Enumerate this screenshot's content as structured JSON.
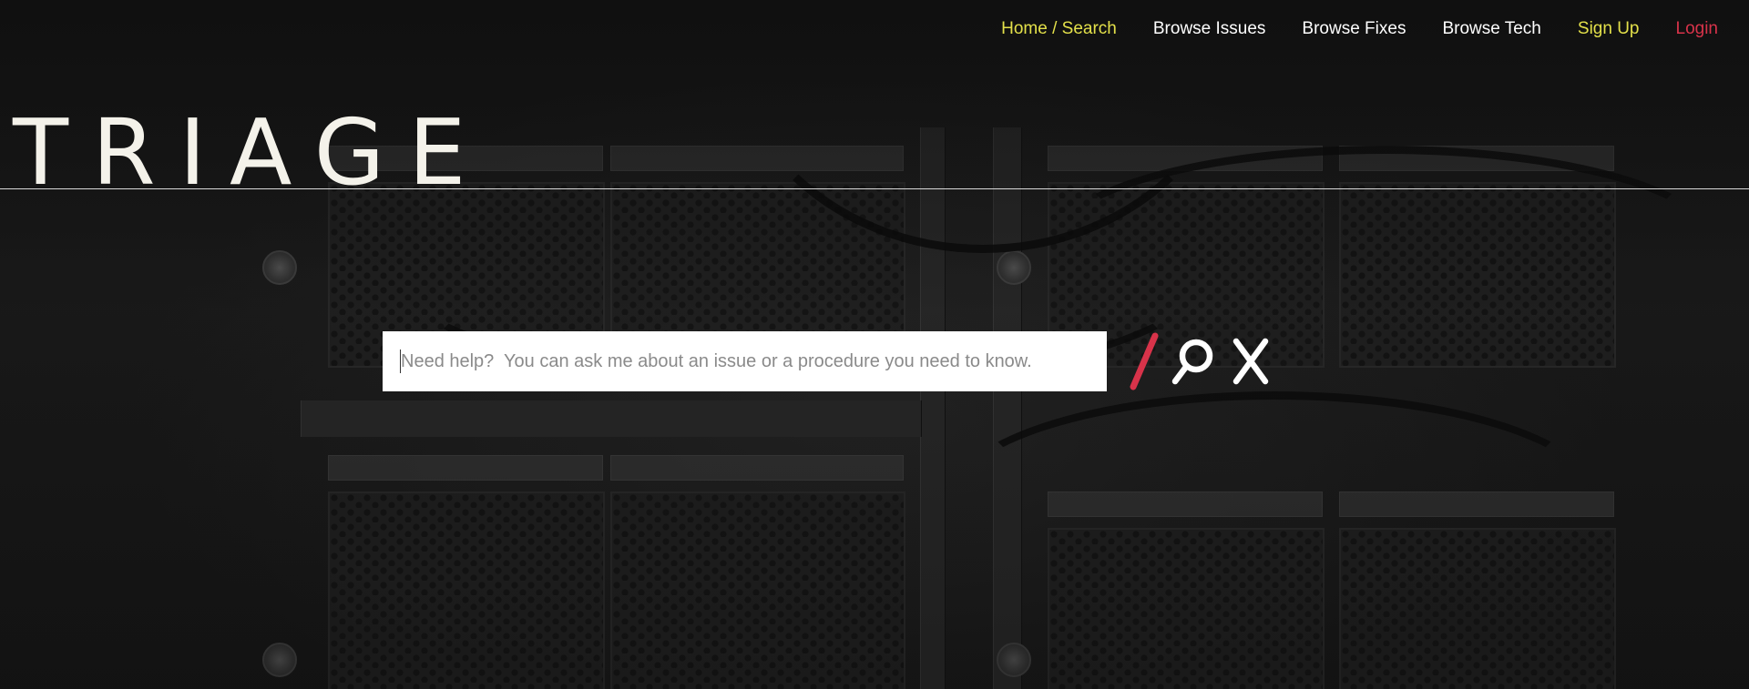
{
  "nav": {
    "items": [
      {
        "label": "Home / Search",
        "color": "#e3e04a"
      },
      {
        "label": "Browse Issues",
        "color": "#ffffff"
      },
      {
        "label": "Browse Fixes",
        "color": "#ffffff"
      },
      {
        "label": "Browse Tech",
        "color": "#ffffff"
      },
      {
        "label": "Sign Up",
        "color": "#e3e04a"
      },
      {
        "label": "Login",
        "color": "#d8334a"
      }
    ]
  },
  "brand": {
    "logo_text": "TRIAGE"
  },
  "search": {
    "value": "",
    "placeholder": "Need help?  You can ask me about an issue or a procedure you need to know."
  },
  "icons": {
    "slash": "slash-icon",
    "search": "magnifier-icon",
    "clear": "close-icon"
  },
  "colors": {
    "accent_yellow": "#e3e04a",
    "accent_red": "#d8334a",
    "background": "#141414",
    "text_light": "#f4f2ea"
  }
}
